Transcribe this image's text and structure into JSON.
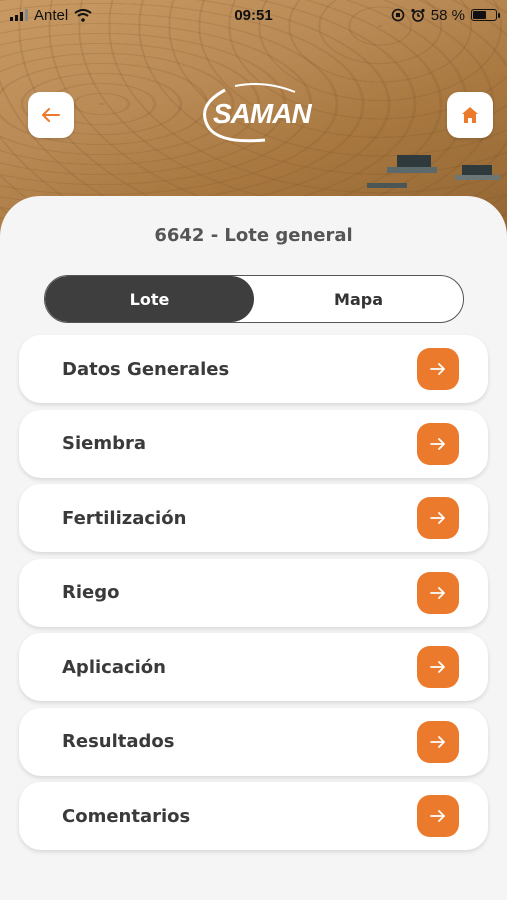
{
  "status_bar": {
    "carrier": "Antel",
    "time": "09:51",
    "battery_percent": "58 %",
    "battery_level": 0.58
  },
  "header": {
    "logo_text": "SAMAN",
    "back_icon": "arrow-left-icon",
    "home_icon": "home-icon"
  },
  "lot": {
    "title": "6642 - Lote general"
  },
  "tabs": [
    {
      "label": "Lote",
      "active": true
    },
    {
      "label": "Mapa",
      "active": false
    }
  ],
  "menu": [
    {
      "label": "Datos Generales"
    },
    {
      "label": "Siembra"
    },
    {
      "label": "Fertilización"
    },
    {
      "label": "Riego"
    },
    {
      "label": "Aplicación"
    },
    {
      "label": "Resultados"
    },
    {
      "label": "Comentarios"
    }
  ],
  "colors": {
    "accent": "#ec7a2c",
    "active_tab": "#3e3e3e"
  }
}
